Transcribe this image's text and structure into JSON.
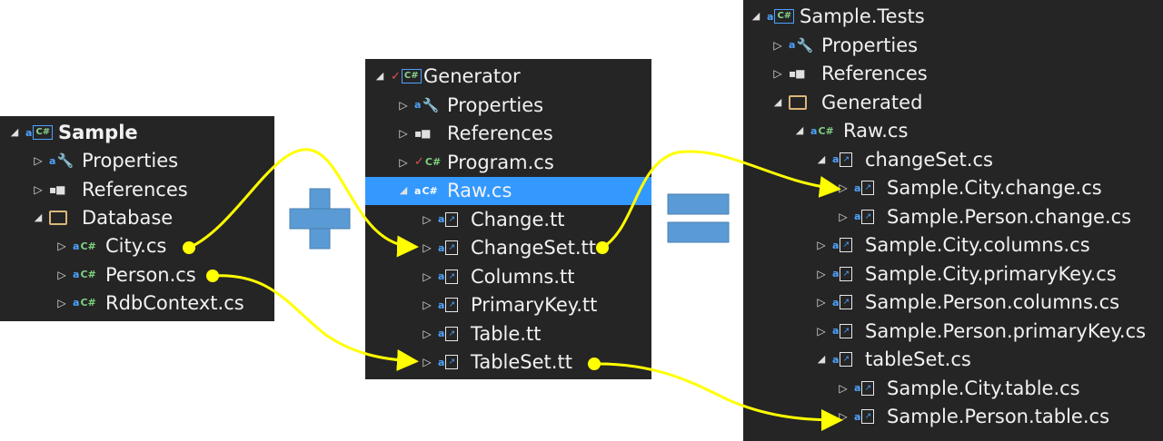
{
  "panels": {
    "left": {
      "items": [
        {
          "label": "Sample",
          "bold": true,
          "exp": "open",
          "icon": "csproj"
        },
        {
          "label": "Properties",
          "exp": "closed",
          "icon": "properties"
        },
        {
          "label": "References",
          "exp": "closed",
          "icon": "references"
        },
        {
          "label": "Database",
          "exp": "open",
          "icon": "folder"
        },
        {
          "label": "City.cs",
          "exp": "closed",
          "icon": "cs"
        },
        {
          "label": "Person.cs",
          "exp": "closed",
          "icon": "cs"
        },
        {
          "label": "RdbContext.cs",
          "exp": "closed",
          "icon": "cs"
        }
      ]
    },
    "middle": {
      "items": [
        {
          "label": "Generator",
          "exp": "open",
          "icon": "csproj-check"
        },
        {
          "label": "Properties",
          "exp": "closed",
          "icon": "properties"
        },
        {
          "label": "References",
          "exp": "closed",
          "icon": "references"
        },
        {
          "label": "Program.cs",
          "exp": "closed",
          "icon": "cs-check"
        },
        {
          "label": "Raw.cs",
          "exp": "open",
          "icon": "cs-gen",
          "selected": true
        },
        {
          "label": "Change.tt",
          "exp": "closed",
          "icon": "tt"
        },
        {
          "label": "ChangeSet.tt",
          "exp": "closed",
          "icon": "tt"
        },
        {
          "label": "Columns.tt",
          "exp": "closed",
          "icon": "tt"
        },
        {
          "label": "PrimaryKey.tt",
          "exp": "closed",
          "icon": "tt"
        },
        {
          "label": "Table.tt",
          "exp": "closed",
          "icon": "tt"
        },
        {
          "label": "TableSet.tt",
          "exp": "closed",
          "icon": "tt"
        }
      ]
    },
    "right": {
      "items": [
        {
          "label": "Sample.Tests",
          "exp": "open",
          "icon": "csproj"
        },
        {
          "label": "Properties",
          "exp": "closed",
          "icon": "properties"
        },
        {
          "label": "References",
          "exp": "closed",
          "icon": "references"
        },
        {
          "label": "Generated",
          "exp": "open",
          "icon": "folder"
        },
        {
          "label": "Raw.cs",
          "exp": "open",
          "icon": "cs"
        },
        {
          "label": "changeSet.cs",
          "exp": "open",
          "icon": "tt"
        },
        {
          "label": "Sample.City.change.cs",
          "exp": "closed",
          "icon": "tt"
        },
        {
          "label": "Sample.Person.change.cs",
          "exp": "closed",
          "icon": "tt"
        },
        {
          "label": "Sample.City.columns.cs",
          "exp": "closed",
          "icon": "tt"
        },
        {
          "label": "Sample.City.primaryKey.cs",
          "exp": "closed",
          "icon": "tt"
        },
        {
          "label": "Sample.Person.columns.cs",
          "exp": "closed",
          "icon": "tt"
        },
        {
          "label": "Sample.Person.primaryKey.cs",
          "exp": "closed",
          "icon": "tt"
        },
        {
          "label": "tableSet.cs",
          "exp": "open",
          "icon": "tt"
        },
        {
          "label": "Sample.City.table.cs",
          "exp": "closed",
          "icon": "tt"
        },
        {
          "label": "Sample.Person.table.cs",
          "exp": "closed",
          "icon": "tt"
        }
      ]
    }
  },
  "colors": {
    "panel_bg": "#252526",
    "selection": "#3399ff",
    "connector": "#ffff00",
    "operator": "#5b9bd5"
  }
}
